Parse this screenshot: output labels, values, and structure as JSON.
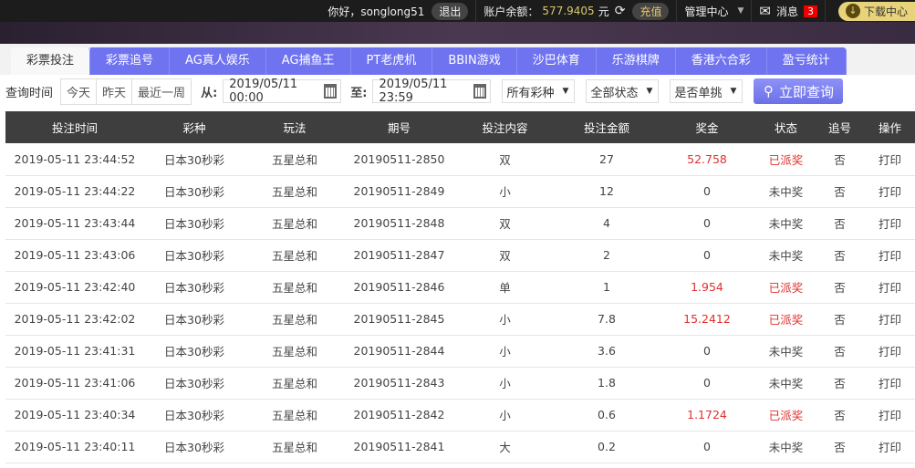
{
  "topbar": {
    "greeting": "你好，songlong51",
    "logout": "退出",
    "balance_label": "账户余额：",
    "balance": "577.9405",
    "currency": "元",
    "recharge": "充值",
    "admin": "管理中心",
    "messages": "消息",
    "message_count": "3",
    "download": "下载中心"
  },
  "tabs": [
    "彩票投注",
    "彩票追号",
    "AG真人娱乐",
    "AG捕鱼王",
    "PT老虎机",
    "BBIN游戏",
    "沙巴体育",
    "乐游棋牌",
    "香港六合彩",
    "盈亏统计"
  ],
  "filters": {
    "query_time": "查询时间",
    "today": "今天",
    "yesterday": "昨天",
    "week": "最近一周",
    "from_label": "从:",
    "from": "2019/05/11 00:00",
    "to_label": "至:",
    "to": "2019/05/11 23:59",
    "lottery": "所有彩种",
    "status": "全部状态",
    "single": "是否单挑",
    "query": "立即查询"
  },
  "columns": [
    "投注时间",
    "彩种",
    "玩法",
    "期号",
    "投注内容",
    "投注金额",
    "奖金",
    "状态",
    "追号",
    "操作"
  ],
  "rows": [
    [
      "2019-05-11 23:44:52",
      "日本30秒彩",
      "五星总和",
      "20190511-2850",
      "双",
      "27",
      "52.758",
      "已派奖",
      "否",
      "打印"
    ],
    [
      "2019-05-11 23:44:22",
      "日本30秒彩",
      "五星总和",
      "20190511-2849",
      "小",
      "12",
      "0",
      "未中奖",
      "否",
      "打印"
    ],
    [
      "2019-05-11 23:43:44",
      "日本30秒彩",
      "五星总和",
      "20190511-2848",
      "双",
      "4",
      "0",
      "未中奖",
      "否",
      "打印"
    ],
    [
      "2019-05-11 23:43:06",
      "日本30秒彩",
      "五星总和",
      "20190511-2847",
      "双",
      "2",
      "0",
      "未中奖",
      "否",
      "打印"
    ],
    [
      "2019-05-11 23:42:40",
      "日本30秒彩",
      "五星总和",
      "20190511-2846",
      "单",
      "1",
      "1.954",
      "已派奖",
      "否",
      "打印"
    ],
    [
      "2019-05-11 23:42:02",
      "日本30秒彩",
      "五星总和",
      "20190511-2845",
      "小",
      "7.8",
      "15.2412",
      "已派奖",
      "否",
      "打印"
    ],
    [
      "2019-05-11 23:41:31",
      "日本30秒彩",
      "五星总和",
      "20190511-2844",
      "小",
      "3.6",
      "0",
      "未中奖",
      "否",
      "打印"
    ],
    [
      "2019-05-11 23:41:06",
      "日本30秒彩",
      "五星总和",
      "20190511-2843",
      "小",
      "1.8",
      "0",
      "未中奖",
      "否",
      "打印"
    ],
    [
      "2019-05-11 23:40:34",
      "日本30秒彩",
      "五星总和",
      "20190511-2842",
      "小",
      "0.6",
      "1.1724",
      "已派奖",
      "否",
      "打印"
    ],
    [
      "2019-05-11 23:40:11",
      "日本30秒彩",
      "五星总和",
      "20190511-2841",
      "大",
      "0.2",
      "0",
      "未中奖",
      "否",
      "打印"
    ]
  ]
}
